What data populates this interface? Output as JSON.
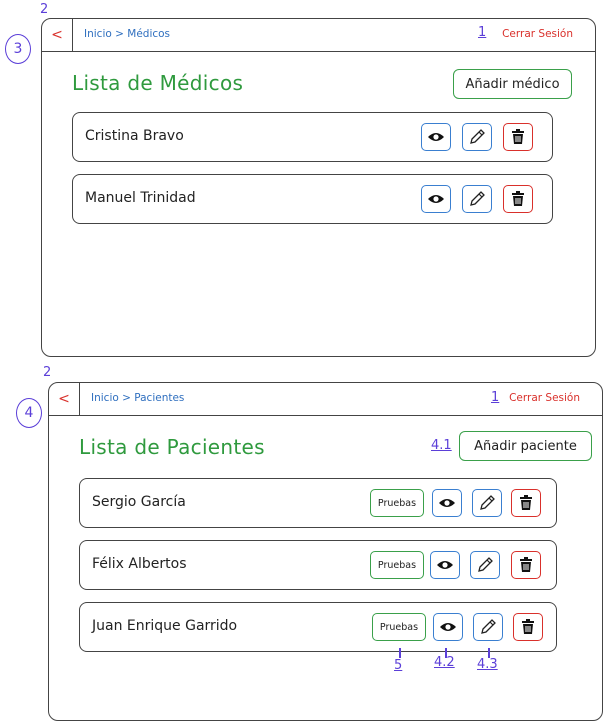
{
  "annotations": {
    "circle_top": "3",
    "circle_bottom": "4",
    "top_num2": "2",
    "top_num1": "1",
    "bottom_num2": "2",
    "bottom_num1": "1",
    "add_patient_num": "4.1",
    "pruebas_num": "5",
    "view_num": "4.2",
    "edit_num": "4.3"
  },
  "medicos_screen": {
    "back_label": "<",
    "breadcrumb": "Inicio > Médicos",
    "logout": "Cerrar Sesión",
    "title": "Lista de Médicos",
    "add_label": "Añadir médico",
    "rows": [
      {
        "name": "Cristina Bravo"
      },
      {
        "name": "Manuel Trinidad"
      }
    ]
  },
  "pacientes_screen": {
    "back_label": "<",
    "breadcrumb": "Inicio > Pacientes",
    "logout": "Cerrar Sesión",
    "title": "Lista de Pacientes",
    "add_label": "Añadir paciente",
    "pruebas_label": "Pruebas",
    "rows": [
      {
        "name": "Sergio García"
      },
      {
        "name": "Félix Albertos"
      },
      {
        "name": "Juan Enrique Garrido"
      }
    ]
  },
  "icons": {
    "view": "eye-icon",
    "edit": "pencil-icon",
    "delete": "trash-icon"
  },
  "colors": {
    "title_green": "#2f9a3e",
    "button_green": "#3aa04a",
    "link_blue": "#2f6fbf",
    "danger_red": "#d9302b",
    "annotation_purple": "#5b3fd8"
  }
}
